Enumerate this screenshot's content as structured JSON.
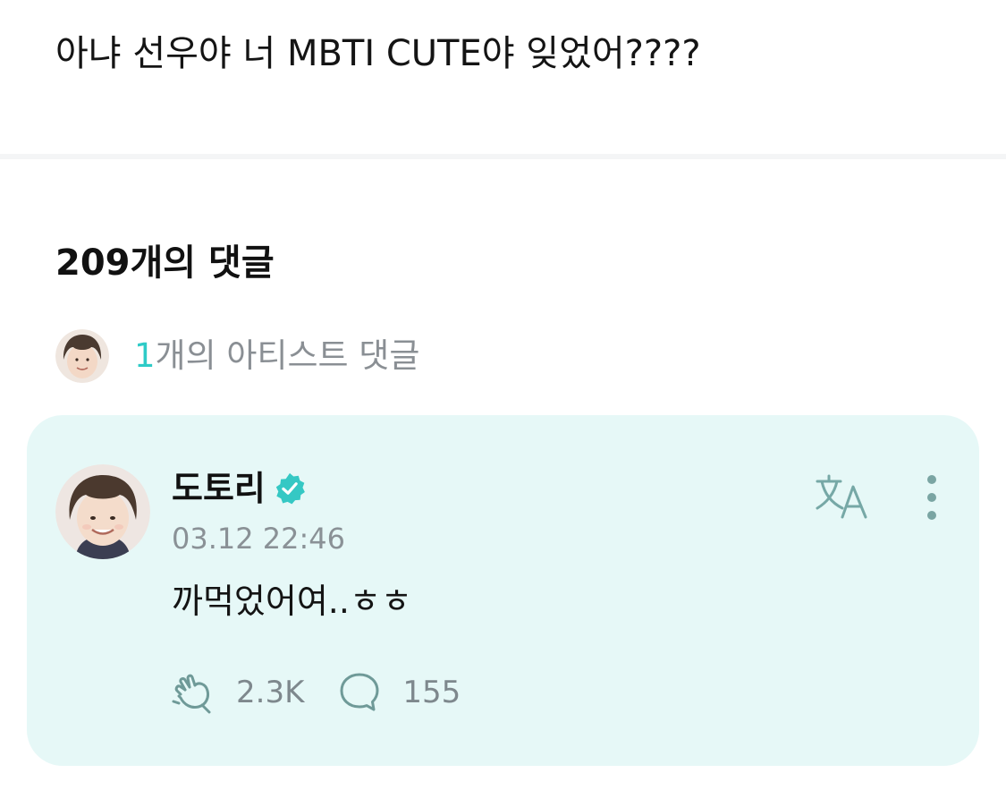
{
  "post": {
    "text": "아냐 선우야 너 MBTI CUTE야 잊었어????"
  },
  "comments_section": {
    "heading": "209개의 댓글",
    "artist_summary": {
      "count": "1",
      "label": "개의 아티스트 댓글"
    }
  },
  "comment": {
    "author": "도토리",
    "verified_icon": "verified-badge-icon",
    "timestamp": "03.12 22:46",
    "body": "까먹었어여..ㅎㅎ",
    "translate_icon": "translate-icon",
    "more_icon": "more-vertical-icon",
    "like_icon": "cheer-like-icon",
    "like_count": "2.3K",
    "reply_icon": "speech-bubble-icon",
    "reply_count": "155"
  },
  "colors": {
    "accent": "#2ecbc7",
    "card_background": "#e6f8f7",
    "muted_text": "#8a8f94",
    "icon_gray": "#6f9a98"
  }
}
